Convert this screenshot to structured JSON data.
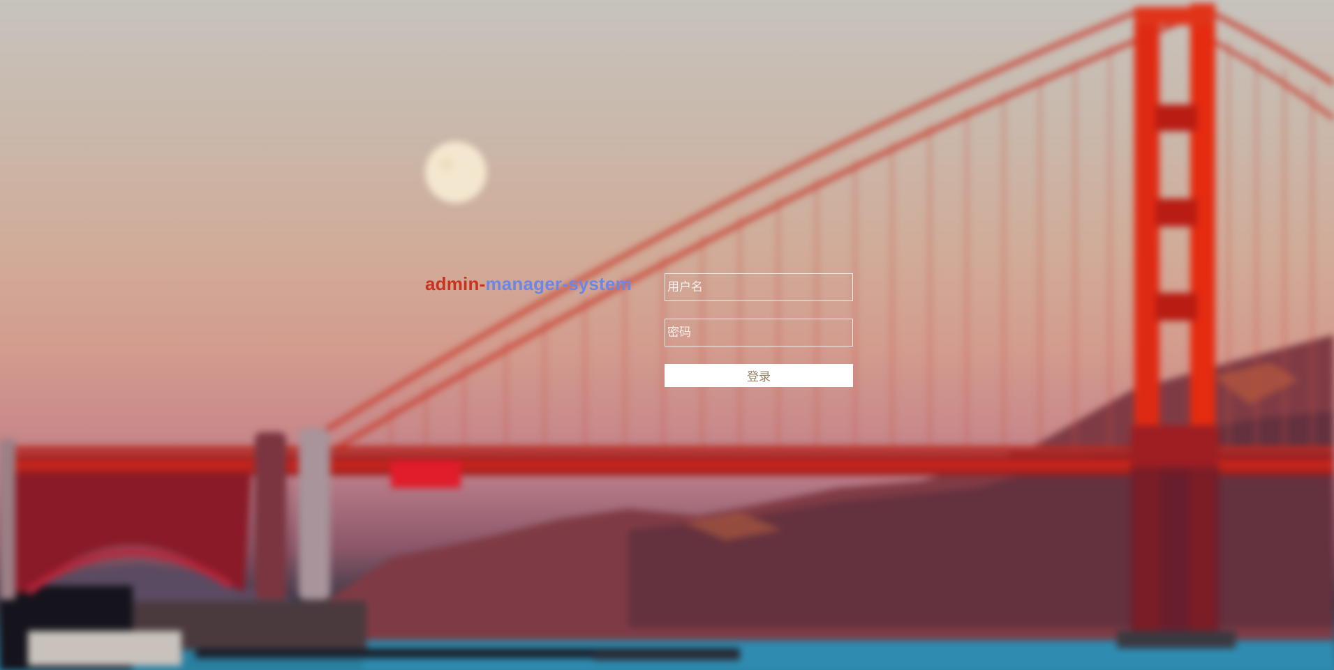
{
  "app": {
    "title_part1": "admin-",
    "title_part2": "manager-system",
    "title_colors": {
      "part1": "#c9321f",
      "part2": "#6b86e6"
    }
  },
  "login": {
    "username_placeholder": "用户名",
    "username_value": "",
    "password_placeholder": "密码",
    "password_value": "",
    "submit_label": "登录"
  },
  "background": {
    "subject": "golden-gate-bridge-at-dusk",
    "icon": "background-photo",
    "colors": {
      "sky_top": "#c7c3bd",
      "sky_mid": "#d39c8e",
      "bridge_red": "#d9230f",
      "hills": "#7e3d45",
      "water": "#2a84a4",
      "moon": "#f3e6cc"
    }
  }
}
